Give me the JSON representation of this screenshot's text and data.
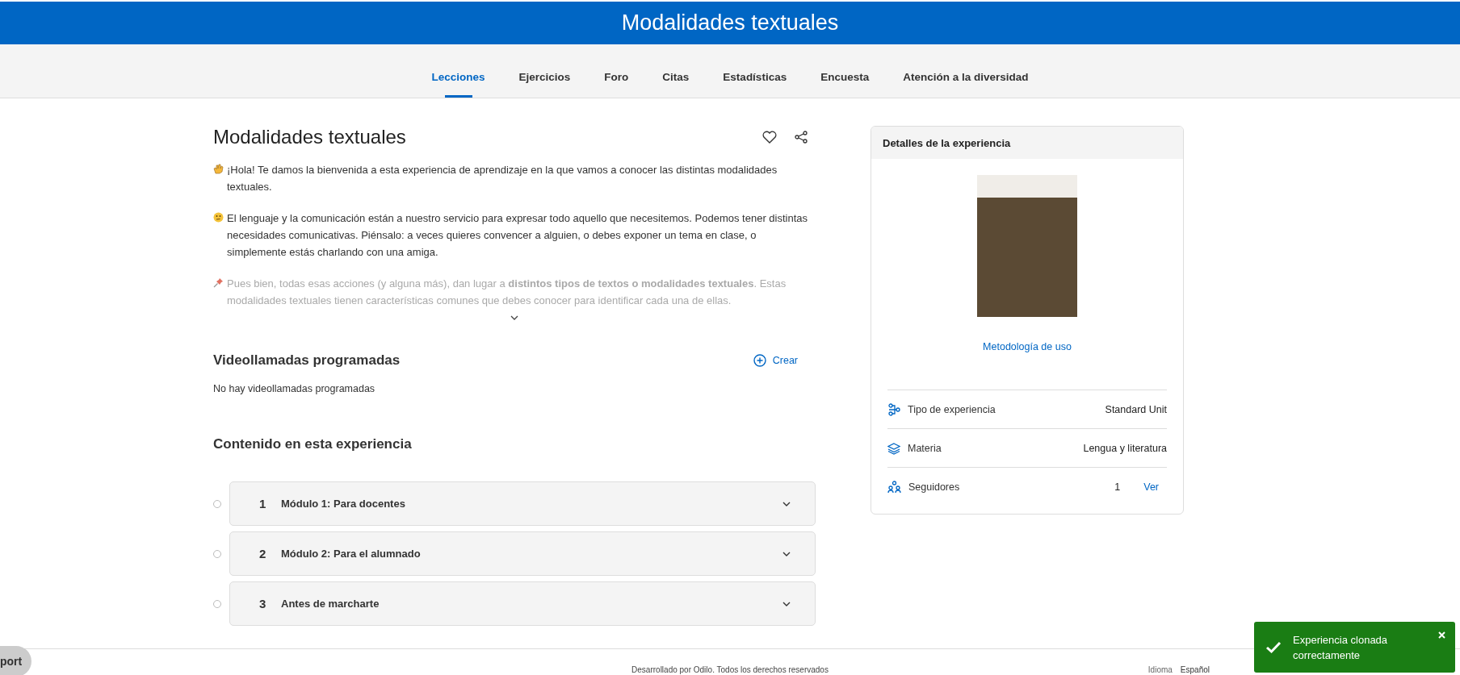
{
  "header": {
    "title": "Modalidades textuales"
  },
  "tabs": [
    {
      "label": "Lecciones",
      "selected": true
    },
    {
      "label": "Ejercicios",
      "selected": false
    },
    {
      "label": "Foro",
      "selected": false
    },
    {
      "label": "Citas",
      "selected": false
    },
    {
      "label": "Estadísticas",
      "selected": false
    },
    {
      "label": "Encuesta",
      "selected": false
    },
    {
      "label": "Atención a la diversidad",
      "selected": false
    }
  ],
  "experience": {
    "title": "Modalidades textuales",
    "liked": false,
    "description": {
      "expanded": false,
      "paragraphs": [
        {
          "kind": "wave",
          "text": "¡Hola! Te damos la bienvenida a esta experiencia de aprendizaje en la que vamos a conocer las distintas modalidades textuales."
        },
        {
          "kind": "thinking",
          "text": "El lenguaje y la comunicación están a nuestro servicio para expresar todo aquello que necesitemos. Podemos tener distintas necesidades comunicativas. Piénsalo: a veces quieres convencer a alguien, o debes exponer un tema en clase, o simplemente estás charlando con una amiga."
        },
        {
          "kind": "pin",
          "text": "Pues bien, todas esas acciones (y alguna más), dan lugar a **distintos tipos de textos o modalidades textuales**. Estas modalidades textuales tienen características comunes que debes conocer para identificar cada una de ellas."
        }
      ]
    }
  },
  "videocalls": {
    "title": "Videollamadas programadas",
    "create_label": "Crear",
    "empty": "No hay videollamadas programadas"
  },
  "content": {
    "title": "Contenido en esta experiencia",
    "modules": [
      {
        "number": "1",
        "title": "Módulo 1: Para docentes",
        "expanded": false
      },
      {
        "number": "2",
        "title": "Módulo 2: Para el alumnado",
        "expanded": false
      },
      {
        "number": "3",
        "title": "Antes de marcharte",
        "expanded": false
      }
    ]
  },
  "details": {
    "title": "Detalles de la experiencia",
    "link": "Metodología de uso",
    "rows": [
      {
        "kind": "type",
        "label": "Tipo de experiencia",
        "value": "Standard Unit"
      },
      {
        "kind": "subject",
        "label": "Materia",
        "value": "Lengua y literatura"
      },
      {
        "kind": "followers",
        "label": "Seguidores",
        "value": "1",
        "action": "Ver"
      }
    ]
  },
  "footer": {
    "support": "port",
    "text": "Desarrollado por Odilo. Todos los derechos reservados",
    "language_label": "Idioma",
    "language": "Español"
  },
  "toast": {
    "kind": "success",
    "message": "Experiencia clonada correctamente"
  }
}
